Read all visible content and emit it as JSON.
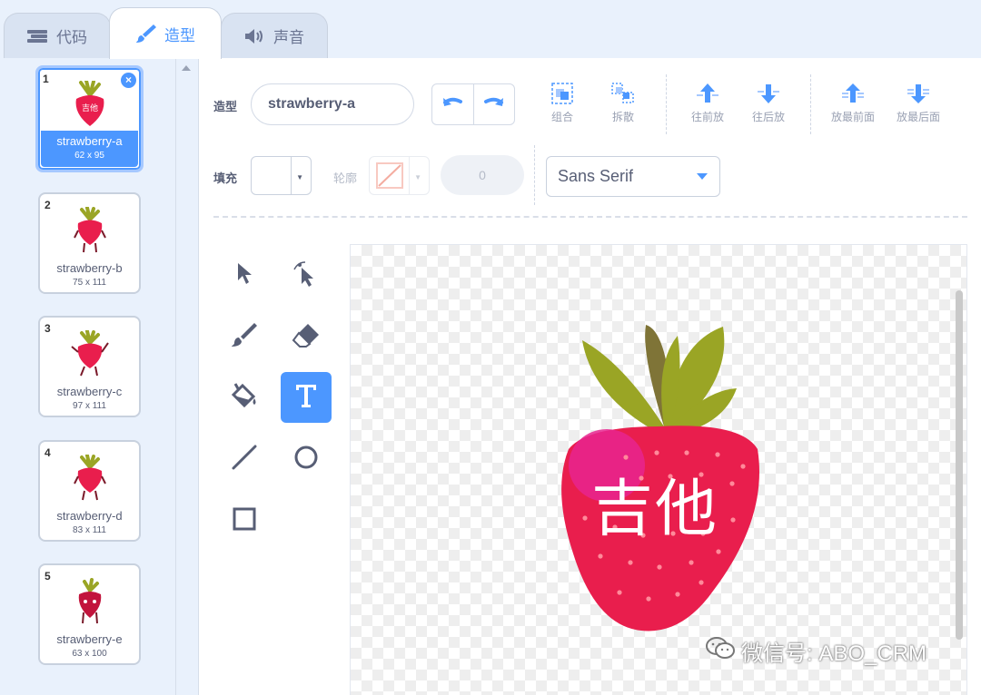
{
  "tabs": [
    {
      "label": "代码",
      "icon": "code-icon"
    },
    {
      "label": "造型",
      "icon": "brush-icon"
    },
    {
      "label": "声音",
      "icon": "speaker-icon"
    }
  ],
  "costumes": [
    {
      "number": "1",
      "name": "strawberry-a",
      "size": "62 x 95",
      "selected": true
    },
    {
      "number": "2",
      "name": "strawberry-b",
      "size": "75 x 111"
    },
    {
      "number": "3",
      "name": "strawberry-c",
      "size": "97 x 111"
    },
    {
      "number": "4",
      "name": "strawberry-d",
      "size": "83 x 111"
    },
    {
      "number": "5",
      "name": "strawberry-e",
      "size": "63 x 100"
    }
  ],
  "toolbar": {
    "costume_label": "造型",
    "costume_name": "strawberry-a",
    "group": "组合",
    "ungroup": "拆散",
    "forward": "往前放",
    "backward": "往后放",
    "front": "放最前面",
    "back": "放最后面"
  },
  "style": {
    "fill_label": "填充",
    "outline_label": "轮廓",
    "stroke_width": "0",
    "font": "Sans Serif"
  },
  "canvas": {
    "text": "吉他"
  },
  "watermark": "微信号: ABO_CRM",
  "colors": {
    "accent": "#4c97ff",
    "strawberry": "#e91e4d",
    "leaf": "#9aa525",
    "leaf_dark": "#7f7437"
  }
}
